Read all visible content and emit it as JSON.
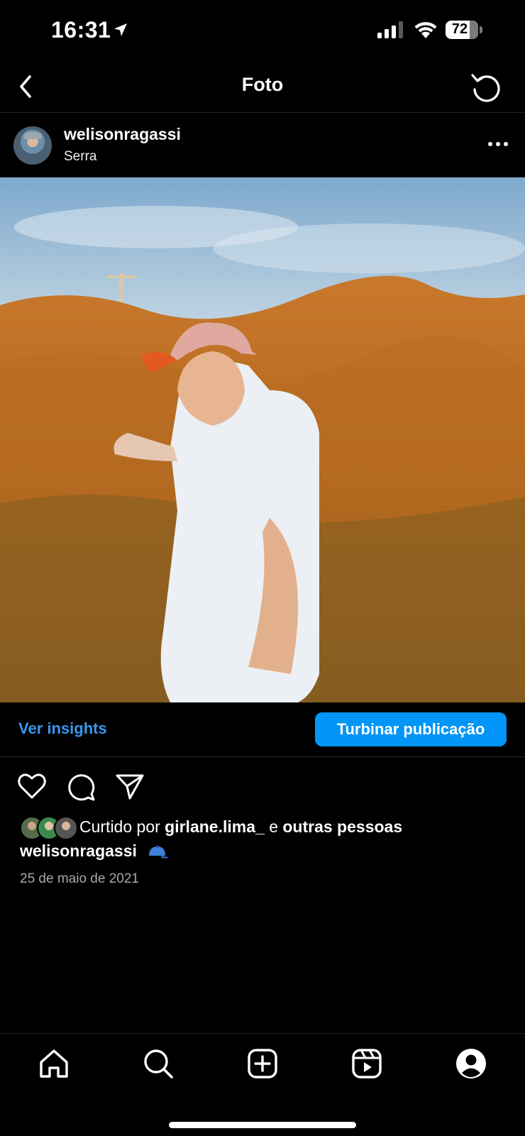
{
  "status_bar": {
    "time": "16:31",
    "battery": "72",
    "icons": [
      "location-arrow-icon",
      "cellular-signal-icon",
      "wifi-icon",
      "battery-icon"
    ]
  },
  "header": {
    "title": "Foto",
    "back_icon": "chevron-left-icon",
    "refresh_icon": "refresh-icon"
  },
  "post": {
    "username": "welisonragassi",
    "location": "Serra",
    "more_icon": "more-horizontal-icon",
    "insights_label": "Ver insights",
    "boost_label": "Turbinar publicação",
    "actions": [
      "heart-icon",
      "comment-icon",
      "share-icon"
    ],
    "likes": {
      "prefix": "Curtido por",
      "user": "girlane.lima_",
      "connector": "e",
      "suffix": "outras pessoas"
    },
    "caption_user": "welisonragassi",
    "caption_emoji": "cap-icon",
    "date": "25 de maio de 2021"
  },
  "tab_bar": {
    "items": [
      "home-icon",
      "search-icon",
      "create-icon",
      "reels-icon",
      "profile-icon"
    ]
  },
  "colors": {
    "accent": "#0095f6",
    "link": "#3797f0",
    "background": "#000000"
  }
}
